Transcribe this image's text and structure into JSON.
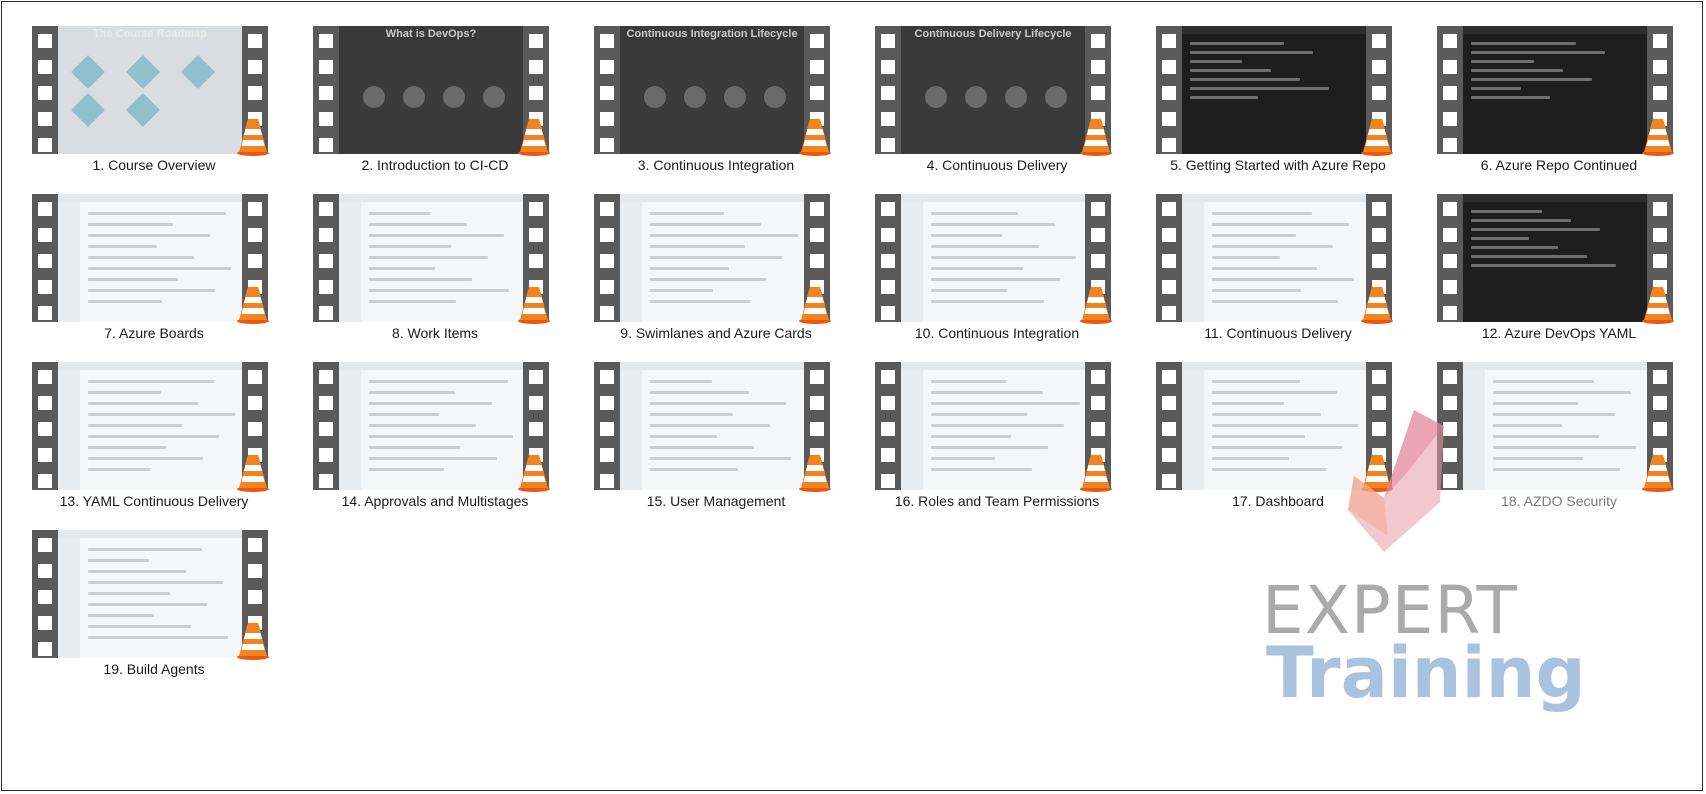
{
  "videos": [
    {
      "caption": "1. Course Overview",
      "screen": "gray",
      "screen_title": "The Course Roadmap"
    },
    {
      "caption": "2. Introduction to CI-CD",
      "screen": "dark",
      "screen_title": "What is DevOps?"
    },
    {
      "caption": "3. Continuous Integration",
      "screen": "dark",
      "screen_title": "Continuous Integration Lifecycle"
    },
    {
      "caption": "4. Continuous Delivery",
      "screen": "dark",
      "screen_title": "Continuous Delivery Lifecycle"
    },
    {
      "caption": "5. Getting Started with Azure Repo",
      "screen": "darker",
      "screen_title": ""
    },
    {
      "caption": "6. Azure Repo Continued",
      "screen": "darker",
      "screen_title": ""
    },
    {
      "caption": "7. Azure Boards",
      "screen": "light",
      "screen_title": ""
    },
    {
      "caption": "8. Work Items",
      "screen": "light",
      "screen_title": ""
    },
    {
      "caption": "9. Swimlanes and Azure Cards",
      "screen": "light",
      "screen_title": ""
    },
    {
      "caption": "10. Continuous Integration",
      "screen": "light",
      "screen_title": ""
    },
    {
      "caption": "11. Continuous Delivery",
      "screen": "light",
      "screen_title": ""
    },
    {
      "caption": "12. Azure DevOps YAML",
      "screen": "darker",
      "screen_title": ""
    },
    {
      "caption": "13. YAML Continuous Delivery",
      "screen": "light",
      "screen_title": ""
    },
    {
      "caption": "14. Approvals and Multistages",
      "screen": "light",
      "screen_title": ""
    },
    {
      "caption": "15. User Management",
      "screen": "light",
      "screen_title": ""
    },
    {
      "caption": "16. Roles and Team Permissions",
      "screen": "light",
      "screen_title": ""
    },
    {
      "caption": "17. Dashboard",
      "screen": "light",
      "screen_title": ""
    },
    {
      "caption": "18. AZDO Security",
      "screen": "light",
      "screen_title": "",
      "faded": true
    },
    {
      "caption": "19. Build Agents",
      "screen": "light",
      "screen_title": ""
    }
  ],
  "watermark": {
    "line1": "EXPERT",
    "line2": "Training",
    "colors": {
      "gray": "#8e8e8e",
      "blue": "#7aa3cf",
      "pink": "#e89aa9",
      "orange": "#f2a98a"
    }
  },
  "icon_names": {
    "thumbnail_overlay": "vlc-cone-icon",
    "film_edges": "film-strip-icon"
  }
}
